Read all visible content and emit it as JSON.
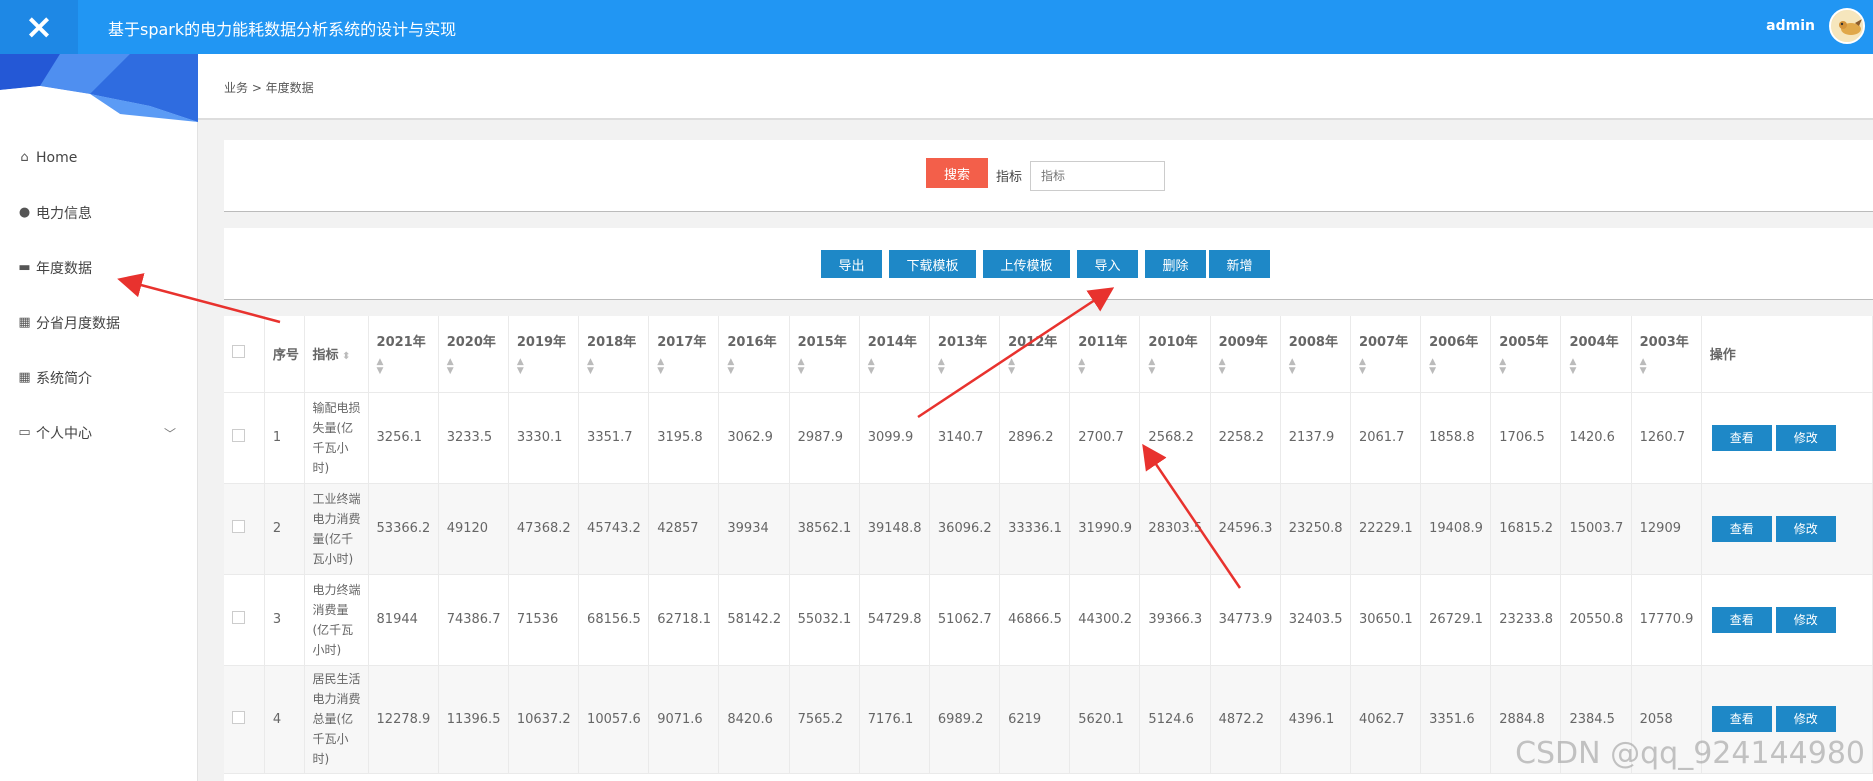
{
  "header": {
    "close_icon": "×",
    "title": "基于spark的电力能耗数据分析系统的设计与实现",
    "user": "admin"
  },
  "sidebar": {
    "items": [
      {
        "icon": "⌂",
        "label": "Home"
      },
      {
        "icon": "●",
        "label": "电力信息"
      },
      {
        "icon": "▬",
        "label": "年度数据"
      },
      {
        "icon": "▦",
        "label": "分省月度数据"
      },
      {
        "icon": "▦",
        "label": "系统简介"
      },
      {
        "icon": "▭",
        "label": "个人中心",
        "chevron": "﹀"
      }
    ]
  },
  "breadcrumb": "业务 > 年度数据",
  "search": {
    "button": "搜索",
    "label": "指标",
    "placeholder": "指标"
  },
  "actions": [
    "导出",
    "下载模板",
    "上传模板",
    "导入",
    "删除",
    "新增"
  ],
  "table": {
    "headers": {
      "index": "序号",
      "metric": "指标",
      "years": [
        "2021年",
        "2020年",
        "2019年",
        "2018年",
        "2017年",
        "2016年",
        "2015年",
        "2014年",
        "2013年",
        "2012年",
        "2011年",
        "2010年",
        "2009年",
        "2008年",
        "2007年",
        "2006年",
        "2005年",
        "2004年",
        "2003年"
      ],
      "ops": "操作"
    },
    "rows": [
      {
        "index": "1",
        "metric_lines": [
          "输配电损",
          "失量(亿",
          "千瓦小",
          "时)"
        ],
        "values": [
          "3256.1",
          "3233.5",
          "3330.1",
          "3351.7",
          "3195.8",
          "3062.9",
          "2987.9",
          "3099.9",
          "3140.7",
          "2896.2",
          "2700.7",
          "2568.2",
          "2258.2",
          "2137.9",
          "2061.7",
          "1858.8",
          "1706.5",
          "1420.6",
          "1260.7"
        ]
      },
      {
        "index": "2",
        "metric_lines": [
          "工业终端",
          "电力消费",
          "量(亿千",
          "瓦小时)"
        ],
        "values": [
          "53366.2",
          "49120",
          "47368.2",
          "45743.2",
          "42857",
          "39934",
          "38562.1",
          "39148.8",
          "36096.2",
          "33336.1",
          "31990.9",
          "28303.5",
          "24596.3",
          "23250.8",
          "22229.1",
          "19408.9",
          "16815.2",
          "15003.7",
          "12909"
        ]
      },
      {
        "index": "3",
        "metric_lines": [
          "电力终端",
          "消费量",
          "(亿千瓦",
          "小时)"
        ],
        "values": [
          "81944",
          "74386.7",
          "71536",
          "68156.5",
          "62718.1",
          "58142.2",
          "55032.1",
          "54729.8",
          "51062.7",
          "46866.5",
          "44300.2",
          "39366.3",
          "34773.9",
          "32403.5",
          "30650.1",
          "26729.1",
          "23233.8",
          "20550.8",
          "17770.9"
        ]
      },
      {
        "index": "4",
        "metric_lines": [
          "居民生活",
          "电力消费",
          "总量(亿",
          "千瓦小",
          "时)"
        ],
        "values": [
          "12278.9",
          "11396.5",
          "10637.2",
          "10057.6",
          "9071.6",
          "8420.6",
          "7565.2",
          "7176.1",
          "6989.2",
          "6219",
          "5620.1",
          "5124.6",
          "4872.2",
          "4396.1",
          "4062.7",
          "3351.6",
          "2884.8",
          "2384.5",
          "2058"
        ]
      }
    ],
    "view_label": "查看",
    "edit_label": "修改"
  },
  "watermark": "CSDN @qq_924144980",
  "colors": {
    "header": "#2196f3",
    "search_button": "#f35f4a",
    "action_button": "#1e88c7",
    "annotation_arrow": "#e8322e"
  }
}
